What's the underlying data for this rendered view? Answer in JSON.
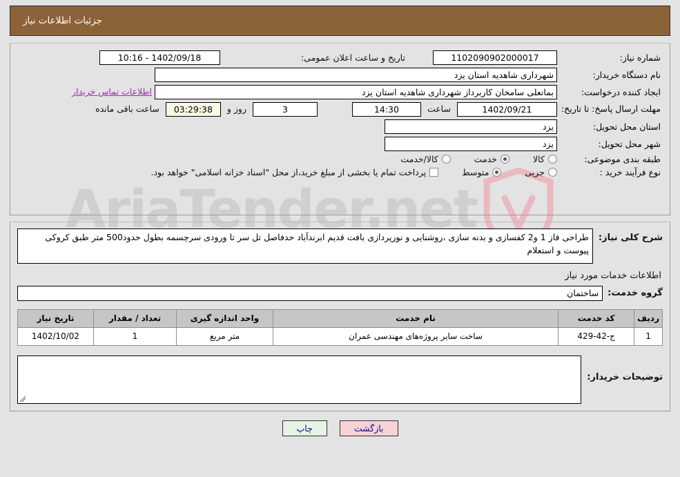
{
  "header": {
    "title": "جزئیات اطلاعات نیاز",
    "bg": "#8c6239"
  },
  "watermark": {
    "text": "AriaTender.net",
    "shield_color": "#e8b7bd",
    "text_color": "#cfcfcf"
  },
  "top_info": {
    "req_no_label": "شماره نیاز:",
    "req_no_value": "1102090902000017",
    "public_announce_label": "تاریخ و ساعت اعلان عمومی:",
    "public_announce_value": "1402/09/18 - 10:16",
    "buyer_org_label": "نام دستگاه خریدار:",
    "buyer_org_value": "شهرداری شاهدیه استان یزد",
    "creator_label": "ایجاد کننده درخواست:",
    "creator_value": "بمانعلی سامخان کاربرداز شهرداری شاهدیه استان یزد",
    "contact_link": "اطلاعات تماس خریدار",
    "deadline_label": "مهلت ارسال پاسخ: تا تاریخ:",
    "deadline_date": "1402/09/21",
    "hour_label": "ساعت",
    "deadline_time": "14:30",
    "days_value": "3",
    "days_label": "روز و",
    "countdown_value": "03:29:38",
    "countdown_label": "ساعت باقی مانده",
    "province_label": "استان محل تحویل:",
    "province_value": "یزد",
    "city_label": "شهر محل تحویل:",
    "city_value": "یزد",
    "category_label": "طبقه بندی موضوعی:",
    "category_options": [
      "کالا",
      "خدمت",
      "کالا/خدمت"
    ],
    "category_selected": "خدمت",
    "process_label": "نوع فرآیند خرید :",
    "process_options": [
      "جزیی",
      "متوسط"
    ],
    "process_selected": "متوسط",
    "treasury_checkbox_checked": false,
    "treasury_note": "پرداخت تمام یا بخشی از مبلغ خرید،از محل \"اسناد خزانه اسلامی\" خواهد بود."
  },
  "description": {
    "label": "شرح کلی نیاز:",
    "value": "طراحی فاز 1 و2 کفسازی و بدنه سازی ،روشنایی و نورپردازی بافت قدیم ابرندآباد حدفاصل تل سر تا ورودی سرچسمه بطول حدود500 متر طبق کروکی پیوست و استعلام"
  },
  "services": {
    "heading": "اطلاعات خدمات مورد نیاز",
    "group_label": "گروه خدمت:",
    "group_value": "ساختمان",
    "columns": [
      "ردیف",
      "کد خدمت",
      "نام خدمت",
      "واحد اندازه گیری",
      "تعداد / مقدار",
      "تاریخ نیاز"
    ],
    "rows": [
      {
        "row_no": "1",
        "code": "ج-42-429",
        "name": "ساخت سایر پروژه‌های مهندسی عمران",
        "unit": "متر مربع",
        "qty": "1",
        "need_date": "1402/10/02"
      }
    ]
  },
  "comments": {
    "label": "توضیحات خریدار:",
    "value": ""
  },
  "footer": {
    "print_label": "چاپ",
    "back_label": "بازگشت",
    "print_bg": "#e6f4e6",
    "back_bg": "#f8d2d6"
  }
}
